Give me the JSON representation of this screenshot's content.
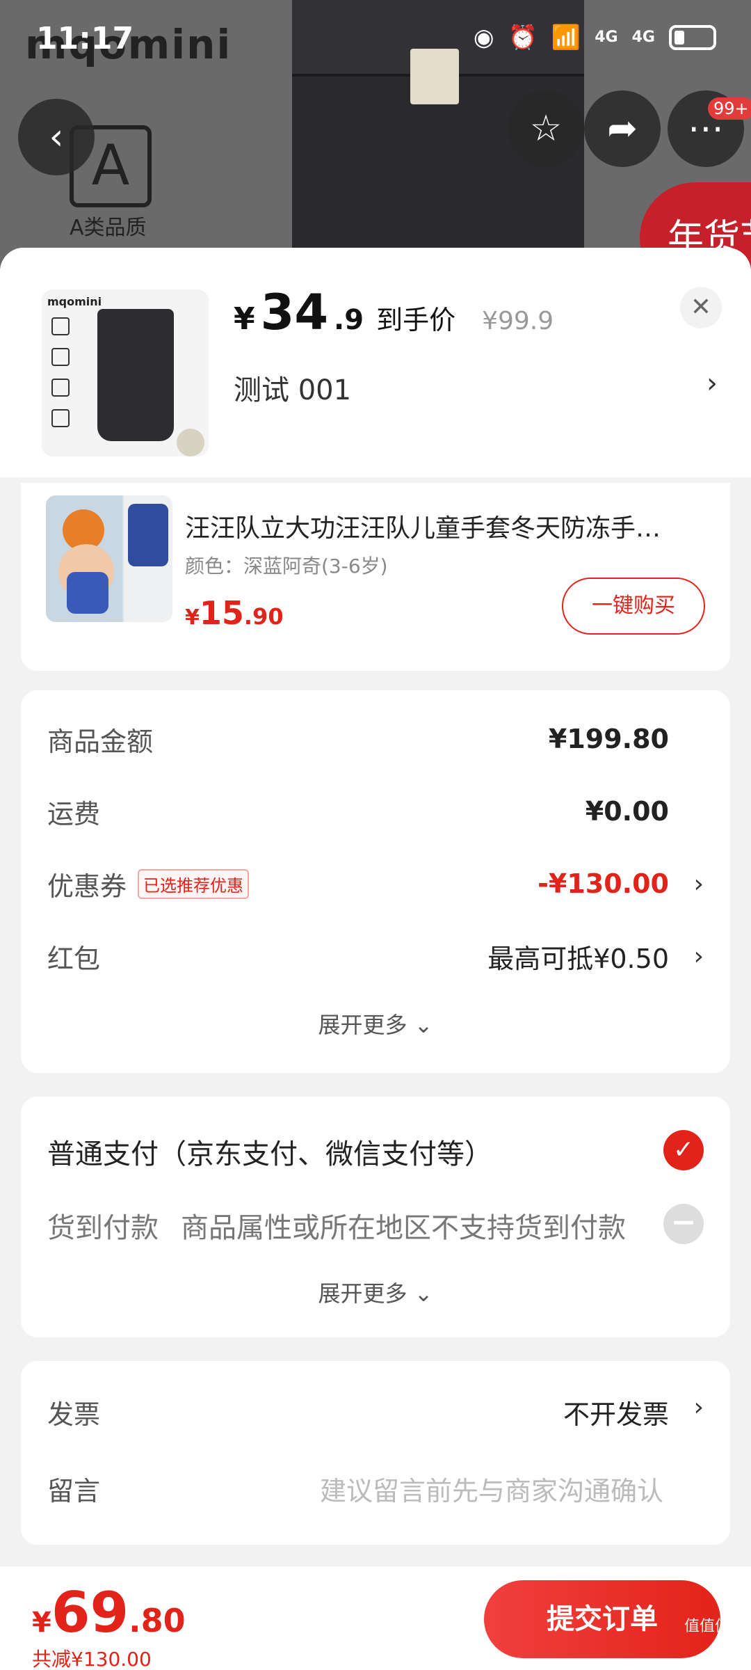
{
  "status_bar": {
    "time": "11:17",
    "signal_1": "4G",
    "signal_2": "4G"
  },
  "background": {
    "brand": "mqomini",
    "grade_letter": "A",
    "grade_text": "A类品质",
    "promo_text": "年货节"
  },
  "nav": {
    "more_badge": "99+"
  },
  "product": {
    "currency": "¥",
    "price_int": "34",
    "price_dec": ".9",
    "price_tag": "到手价",
    "original_price": "¥99.9",
    "variant": "测试  001",
    "thumb_brand": "mqomini"
  },
  "recommend": {
    "title": "汪汪队立大功汪汪队儿童手套冬天防冻手…",
    "spec": "颜色：深蓝阿奇(3-6岁)",
    "price_currency": "¥",
    "price_int": "15",
    "price_dec": ".90",
    "buy_label": "一键购买"
  },
  "summary": {
    "goods_label": "商品金额",
    "goods_value": "¥199.80",
    "shipping_label": "运费",
    "shipping_value": "¥0.00",
    "coupon_label": "优惠券",
    "coupon_tag": "已选推荐优惠",
    "coupon_value": "-¥130.00",
    "redpacket_label": "红包",
    "redpacket_value": "最高可抵¥0.50",
    "expand": "展开更多 ⌄"
  },
  "payment": {
    "normal": "普通支付（京东支付、微信支付等）",
    "cod_label": "货到付款",
    "cod_desc": "商品属性或所在地区不支持货到付款",
    "expand": "展开更多 ⌄"
  },
  "invoice": {
    "label": "发票",
    "value": "不开发票",
    "note_label": "留言",
    "note_placeholder": "建议留言前先与商家沟通确认"
  },
  "bottom": {
    "currency": "¥",
    "total_int": "69",
    "total_dec": ".80",
    "saved": "共减¥130.00",
    "submit_label": "提交订单",
    "watermark": "值值值"
  },
  "colors": {
    "accent": "#e2231a",
    "background": "#f2f2f2"
  }
}
